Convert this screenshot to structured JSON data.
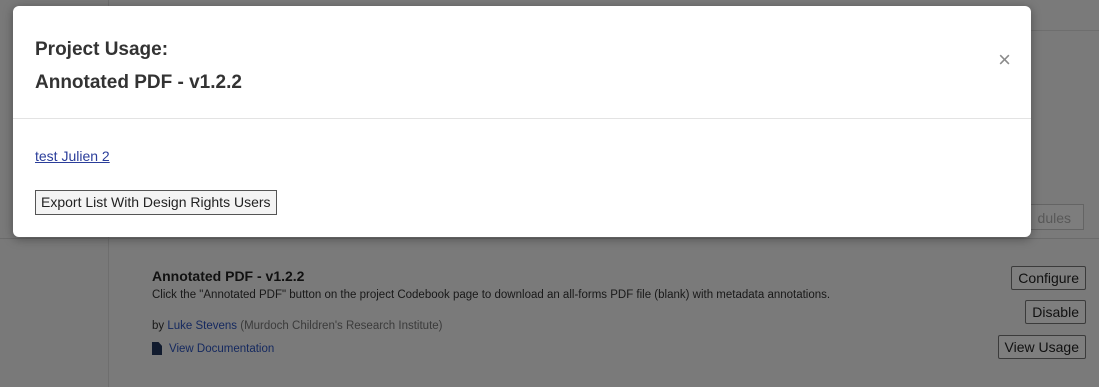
{
  "background": {
    "modules_button_label": "dules",
    "module": {
      "title": "Annotated PDF - v1.2.2",
      "description": "Click the \"Annotated PDF\" button on the project Codebook page to download an all-forms PDF file (blank) with metadata annotations.",
      "by_prefix": "by",
      "author": "Luke Stevens",
      "institution": "(Murdoch Children's Research Institute)",
      "documentation_label": "View Documentation",
      "documentation_icon": "document-icon"
    },
    "buttons": {
      "configure": "Configure",
      "disable": "Disable",
      "view_usage": "View Usage"
    }
  },
  "modal": {
    "title_line1": "Project Usage:",
    "title_line2": "Annotated PDF - v1.2.2",
    "close_symbol": "×",
    "project_link": "test Julien 2",
    "export_button": "Export List With Design Rights Users"
  }
}
